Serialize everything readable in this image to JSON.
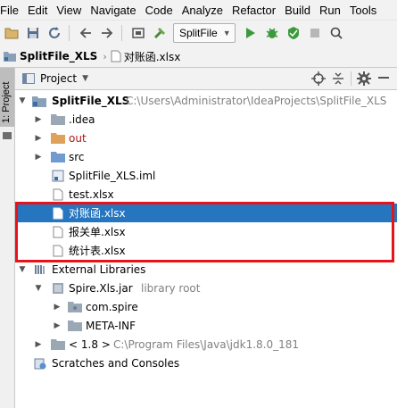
{
  "menu": [
    "File",
    "Edit",
    "View",
    "Navigate",
    "Code",
    "Analyze",
    "Refactor",
    "Build",
    "Run",
    "Tools"
  ],
  "toolbar": {
    "run_config": "SplitFile",
    "icons": [
      "folder-open-icon",
      "save-icon",
      "sync-icon",
      "back-arrow-icon",
      "forward-arrow-icon",
      "frame-icon",
      "build-hammer-icon",
      "run-icon",
      "debug-icon",
      "coverage-icon",
      "stop-icon",
      "search-icon"
    ]
  },
  "breadcrumb": {
    "project": "SplitFile_XLS",
    "file": "对账函.xlsx"
  },
  "sidebar": {
    "tab_label": "1: Project"
  },
  "project_panel": {
    "title": "Project"
  },
  "tree": [
    {
      "label": "SplitFile_XLS",
      "path": "C:\\Users\\Administrator\\IdeaProjects\\SplitFile_XLS"
    },
    {
      "label": ".idea"
    },
    {
      "label": "out"
    },
    {
      "label": "src"
    },
    {
      "label": "SplitFile_XLS.iml"
    },
    {
      "label": "test.xlsx"
    },
    {
      "label": "对账函.xlsx"
    },
    {
      "label": "报关单.xlsx"
    },
    {
      "label": "统计表.xlsx"
    },
    {
      "label": "External Libraries"
    },
    {
      "label": "Spire.Xls.jar",
      "note": "library root"
    },
    {
      "label": "com.spire"
    },
    {
      "label": "META-INF"
    },
    {
      "label": "< 1.8 >",
      "path": "C:\\Program Files\\Java\\jdk1.8.0_181"
    },
    {
      "label": "Scratches and Consoles"
    }
  ],
  "colors": {
    "selection": "#2675bf",
    "highlight_box": "#e8121a",
    "out_folder_text": "#b01717"
  }
}
